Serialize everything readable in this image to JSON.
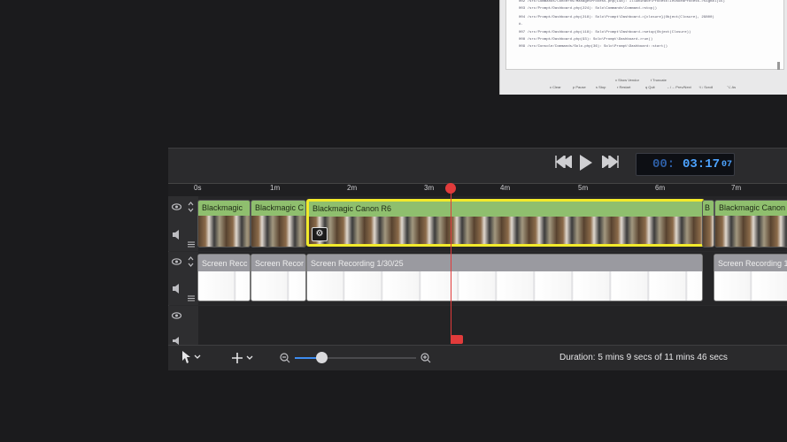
{
  "preview": {
    "log_lines": [
      "002 /src/Commands/Concerns/ManagesProcess.php(148): Illuminate\\Process\\InvokedProcess->signal(15)",
      "003 /src/Prompt/Dashboard.php(224): Solo\\Commands\\Command->stop()",
      "004 /src/Prompt/Dashboard.php(218): Solo\\Prompt\\Dashboard->{closure}(Object(Closure), 29800)",
      "#.",
      "007 /src/Prompt/Dashboard.php(118): Solo\\Prompt\\Dashboard->setup(Object(Closure))",
      "008 /src/Prompt/Dashboard.php(93): Solo\\Prompt\\Dashboard->run()",
      "009 /src/Console/Commands/Solo.php(36): Solo\\Prompt\\Dashboard::start()"
    ],
    "hint_row_1": [
      "v Show Vendor",
      "t Truncate"
    ],
    "hint_row_2": [
      "c Clear",
      "p Pause",
      "s Stop",
      "r Restart",
      "q Quit",
      "←/→ Prev/Next",
      "↑/↓ Scroll",
      "⌥ As"
    ]
  },
  "transport": {
    "rewind_icon": "rewind-icon",
    "play_icon": "play-icon",
    "forward_icon": "fast-forward-icon",
    "timecode_dim": "00:",
    "timecode_main": "03:17",
    "timecode_frames": "07"
  },
  "ruler": {
    "ticks": [
      "0s",
      "1m",
      "2m",
      "3m",
      "4m",
      "5m",
      "6m",
      "7m"
    ]
  },
  "tracks": {
    "video_clips": [
      "Blackmagic",
      "Blackmagic C",
      "Blackmagic Canon R6",
      "B",
      "Blackmagic Canon"
    ],
    "screen_clips": [
      "Screen Recc",
      "Screen Recor",
      "Screen Recording 1/30/25",
      "Screen Recording 1"
    ]
  },
  "bottom": {
    "duration_text": "Duration: 5 mins 9 secs of 11 mins 46 secs",
    "zoom_level": 0.22
  },
  "colors": {
    "selection": "#f2ea2b",
    "playhead": "#e23b3b",
    "video_clip_bar": "#8fbf6e",
    "timecode_blue": "#4da3ff"
  }
}
